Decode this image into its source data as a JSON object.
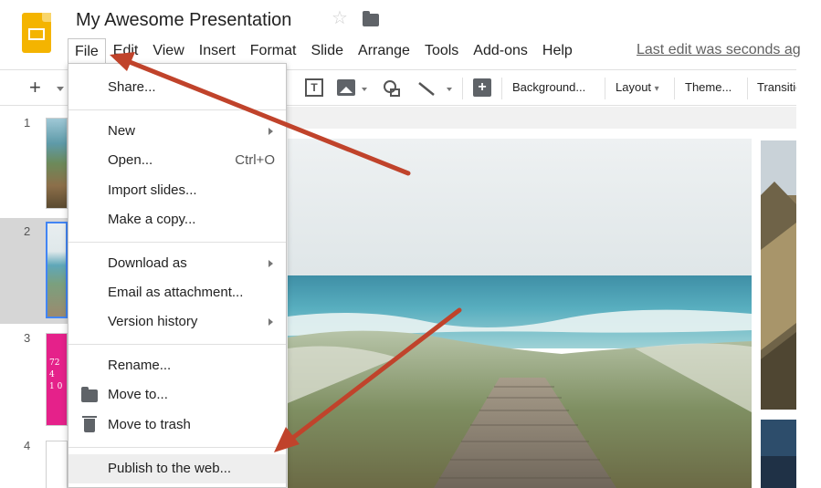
{
  "header": {
    "title": "My Awesome Presentation",
    "star_icon": "star-outline-icon",
    "folder_icon": "folder-icon",
    "last_edit": "Last edit was seconds ago"
  },
  "menubar": [
    "File",
    "Edit",
    "View",
    "Insert",
    "Format",
    "Slide",
    "Arrange",
    "Tools",
    "Add-ons",
    "Help"
  ],
  "toolbar": {
    "textbox_glyph": "T",
    "comment_glyph": "+",
    "background": "Background...",
    "layout": "Layout",
    "layout_caret": "▾",
    "theme": "Theme...",
    "transition": "Transition..."
  },
  "filmstrip": {
    "slides": [
      {
        "number": "1"
      },
      {
        "number": "2",
        "selected": true
      },
      {
        "number": "3",
        "thumb_text": [
          "72",
          "4",
          "1 0"
        ]
      },
      {
        "number": "4"
      }
    ]
  },
  "file_menu": {
    "share": "Share...",
    "new": "New",
    "open": "Open...",
    "open_shortcut": "Ctrl+O",
    "import_slides": "Import slides...",
    "make_copy": "Make a copy...",
    "download_as": "Download as",
    "email_attachment": "Email as attachment...",
    "version_history": "Version history",
    "rename": "Rename...",
    "move_to": "Move to...",
    "move_to_trash": "Move to trash",
    "publish": "Publish to the web..."
  },
  "colors": {
    "accent_blue": "#4285f4",
    "slides_yellow": "#f4b400",
    "annotation_arrow": "#c0432b",
    "slide3_pink": "#e5218a"
  }
}
